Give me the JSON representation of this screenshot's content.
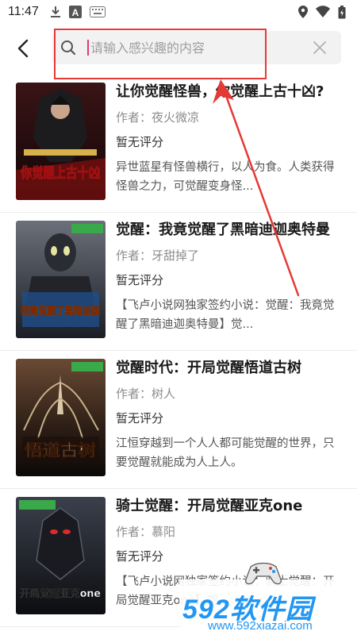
{
  "status_bar": {
    "time": "11:47"
  },
  "search": {
    "placeholder": "请输入感兴趣的内容",
    "value": ""
  },
  "books": [
    {
      "title": "让你觉醒怪兽，你觉醒上古十凶?",
      "author": "作者：夜火微凉",
      "rating": "暂无评分",
      "description": "异世蓝星有怪兽横行，以人为食。人类获得怪兽之力，可觉醒变身怪...",
      "cover_text": "你觉醒上古十凶",
      "cover_colors": [
        "#2a0f12",
        "#8a1a1a"
      ]
    },
    {
      "title": "觉醒：我竟觉醒了黑暗迪迦奥特曼",
      "author": "作者：牙甜掉了",
      "rating": "暂无评分",
      "description": "【飞卢小说网独家签约小说：觉醒：我竟觉醒了黑暗迪迦奥特曼】觉...",
      "cover_text": "我竟觉醒了黑暗迪迦",
      "cover_colors": [
        "#4a4f58",
        "#1b1e24"
      ]
    },
    {
      "title": "觉醒时代：开局觉醒悟道古树",
      "author": "作者：树人",
      "rating": "暂无评分",
      "description": "江恒穿越到一个人人都可能觉醒的世界，只要觉醒就能成为人上人。",
      "cover_text": "悟道古树",
      "cover_colors": [
        "#3b2a20",
        "#0f0b09"
      ]
    },
    {
      "title": "骑士觉醒：开局觉醒亚克one",
      "author": "作者：慕阳",
      "rating": "暂无评分",
      "description": "【飞卢小说网独家签约小说：骑士觉醒：开局觉醒亚克one】觉...",
      "cover_text": "开局觉醒亚克one",
      "cover_colors": [
        "#2b2f38",
        "#0c0d10"
      ]
    }
  ],
  "watermark": {
    "main": "592软件园",
    "url": "www.592xiazai.com"
  },
  "colors": {
    "caret": "#e0387f",
    "annotation": "#e53935",
    "watermark": "#2196f3"
  }
}
